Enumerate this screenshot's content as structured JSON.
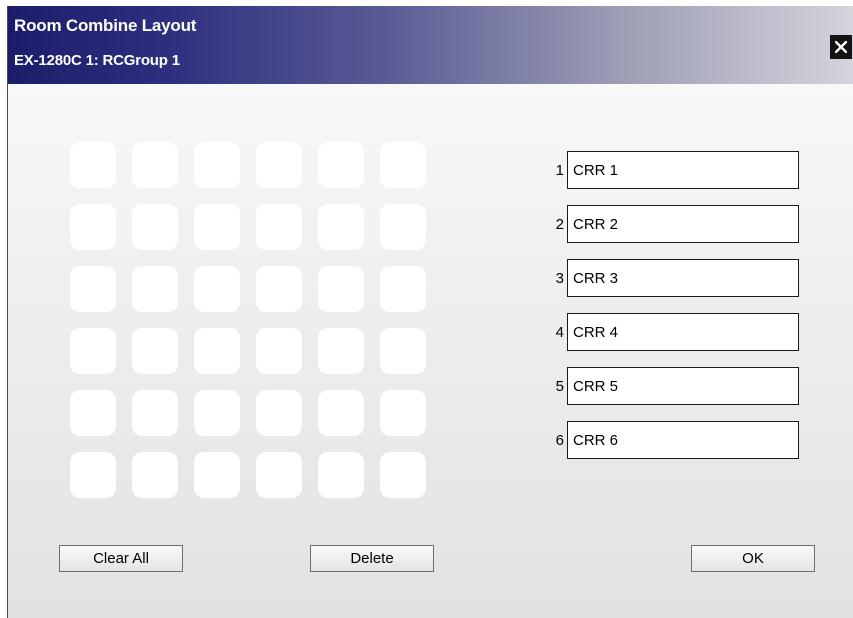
{
  "window": {
    "title": "Room Combine Layout",
    "subtitle": "EX-1280C 1: RCGroup 1",
    "close_icon": "close-x-icon"
  },
  "layout_grid": {
    "rows": 6,
    "columns": 6
  },
  "rooms": [
    {
      "number": "1",
      "name": "CRR 1"
    },
    {
      "number": "2",
      "name": "CRR 2"
    },
    {
      "number": "3",
      "name": "CRR 3"
    },
    {
      "number": "4",
      "name": "CRR 4"
    },
    {
      "number": "5",
      "name": "CRR 5"
    },
    {
      "number": "6",
      "name": "CRR 6"
    }
  ],
  "buttons": {
    "clear_all": "Clear All",
    "delete": "Delete",
    "ok": "OK"
  },
  "colors": {
    "titlebar_dark": "#1c1d6a",
    "titlebar_light": "#d4d4dc",
    "cell": "#ffffff"
  }
}
